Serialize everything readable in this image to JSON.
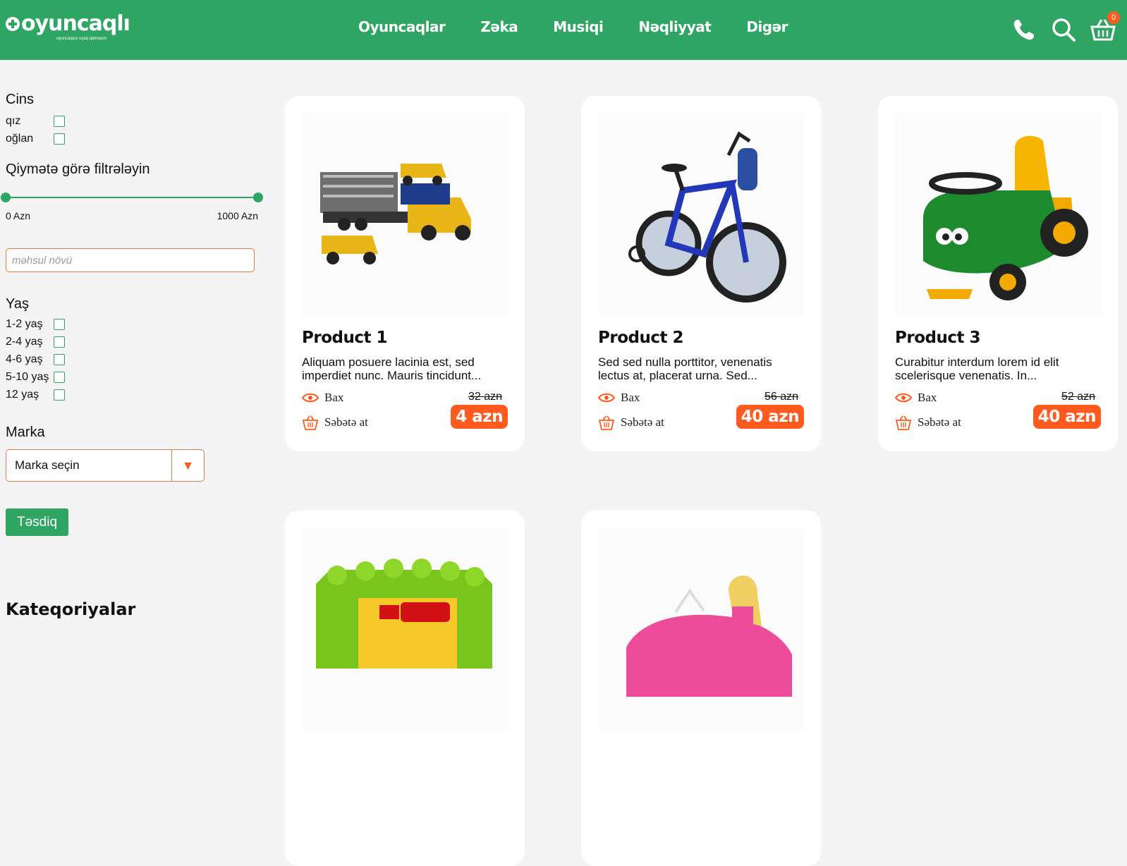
{
  "header": {
    "logo_text": "oyuncaqlı",
    "logo_tagline": "oyuncaqsız uşaq qalmasın",
    "nav": [
      "Oyuncaqlar",
      "Zəka",
      "Musiqi",
      "Nəqliyyat",
      "Digər"
    ],
    "cart_count": "0",
    "icons": [
      "phone-icon",
      "search-icon",
      "basket-icon"
    ],
    "brand_color": "#2ea562",
    "accent_color": "#ff5b1f"
  },
  "sidebar": {
    "gender_title": "Cins",
    "gender_options": [
      "qız",
      "oğlan"
    ],
    "price_title": "Qiymətə görə filtrələyin",
    "price_min": "0 Azn",
    "price_max": "1000 Azn",
    "type_placeholder": "məhsul növü",
    "age_title": "Yaş",
    "age_options": [
      "1-2 yaş",
      "2-4 yaş",
      "4-6 yaş",
      "5-10 yaş",
      "12 yaş"
    ],
    "brand_title": "Marka",
    "brand_select": "Marka seçin",
    "confirm_label": "Təsdiq",
    "categories_title": "Kateqoriyalar"
  },
  "products": [
    {
      "name": "Product 1",
      "desc": "Aliquam posuere lacinia est, sed imperdiet nunc. Mauris tincidunt...",
      "view": "Bax",
      "cart": "Səbətə at",
      "old_price": "32 azn",
      "price": "4 azn"
    },
    {
      "name": "Product 2",
      "desc": "Sed sed nulla porttitor, venenatis lectus at, placerat urna. Sed...",
      "view": "Bax",
      "cart": "Səbətə at",
      "old_price": "56 azn",
      "price": "40 azn"
    },
    {
      "name": "Product 3",
      "desc": "Curabitur interdum lorem id elit scelerisque venenatis. In...",
      "view": "Bax",
      "cart": "Səbətə at",
      "old_price": "52 azn",
      "price": "40 azn"
    },
    {
      "name": "",
      "desc": "",
      "view": "",
      "cart": "",
      "old_price": "",
      "price": ""
    },
    {
      "name": "",
      "desc": "",
      "view": "",
      "cart": "",
      "old_price": "",
      "price": ""
    }
  ]
}
